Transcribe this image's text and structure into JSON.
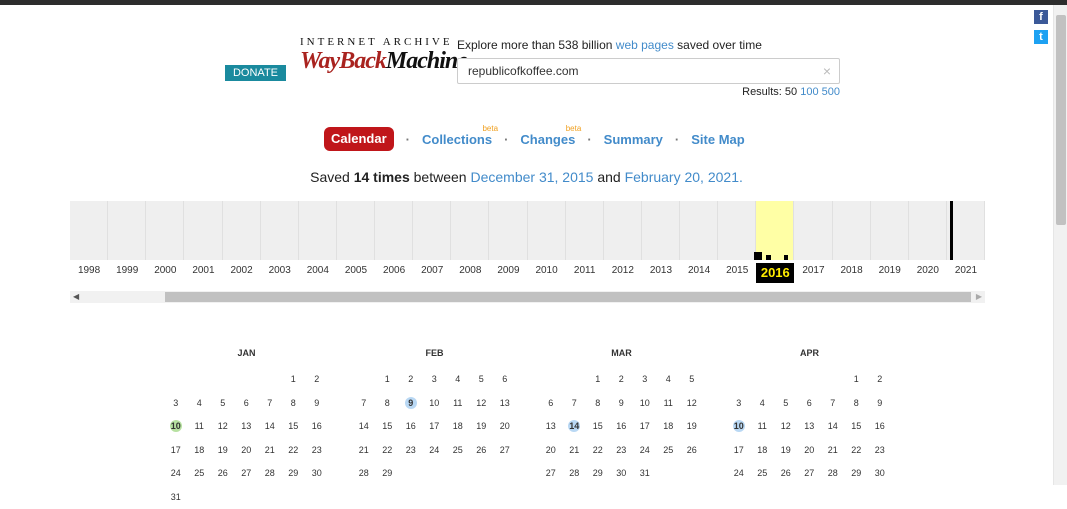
{
  "social": {
    "facebook": "f",
    "twitter": "t"
  },
  "header": {
    "donate_label": "DONATE",
    "logo_top": "INTERNET ARCHIVE",
    "logo_wayback": "WayBack",
    "logo_machine": "Machine",
    "explore_prefix": "Explore more than 538 billion",
    "explore_link": "web pages",
    "explore_suffix": "saved over time",
    "search_value": "republicofkoffee.com",
    "clear_icon": "×",
    "results_label": "Results: 50",
    "results_100": "100",
    "results_500": "500"
  },
  "nav": {
    "calendar": "Calendar",
    "collections": "Collections",
    "changes": "Changes",
    "summary": "Summary",
    "sitemap": "Site Map",
    "beta": "beta",
    "separator": "·"
  },
  "saved": {
    "prefix": "Saved",
    "count": "14 times",
    "between": "between",
    "start": "December 31, 2015",
    "and": "and",
    "end": "February 20, 2021."
  },
  "timeline": {
    "years": [
      "1998",
      "1999",
      "2000",
      "2001",
      "2002",
      "2003",
      "2004",
      "2005",
      "2006",
      "2007",
      "2008",
      "2009",
      "2010",
      "2011",
      "2012",
      "2013",
      "2014",
      "2015",
      "2016",
      "2017",
      "2018",
      "2019",
      "2020",
      "2021"
    ],
    "selected_year": "2016",
    "selected_color": "#ffffa5"
  },
  "calendar": {
    "months": [
      {
        "name": "JAN",
        "offset": 5,
        "days": 31,
        "captures": {
          "10": "green"
        }
      },
      {
        "name": "FEB",
        "offset": 1,
        "days": 29,
        "captures": {
          "9": "blue"
        }
      },
      {
        "name": "MAR",
        "offset": 2,
        "days": 31,
        "captures": {
          "14": "blue"
        }
      },
      {
        "name": "APR",
        "offset": 5,
        "days": 30,
        "captures": {
          "10": "blue"
        }
      }
    ]
  },
  "colors": {
    "accent": "#c0161a",
    "link": "#428bca",
    "donate": "#1a8a9e"
  }
}
